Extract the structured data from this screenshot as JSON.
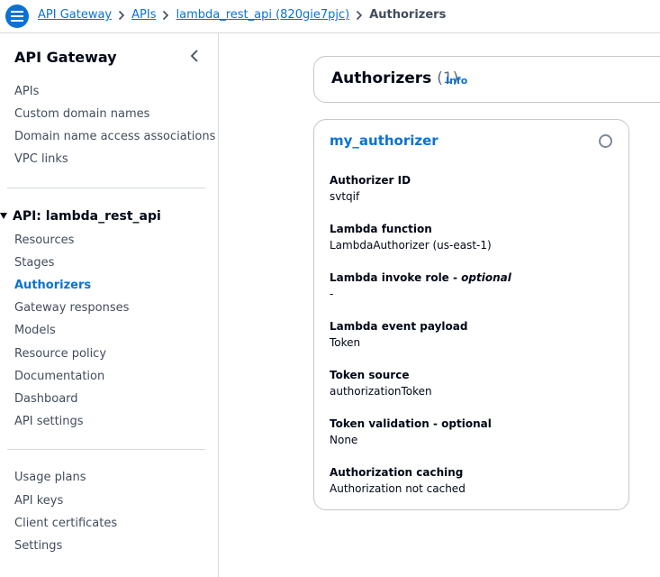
{
  "breadcrumb": {
    "items": [
      "API Gateway",
      "APIs",
      "lambda_rest_api (820gie7pjc)"
    ],
    "current": "Authorizers"
  },
  "sidebar": {
    "title": "API Gateway",
    "group1": [
      "APIs",
      "Custom domain names",
      "Domain name access associations",
      "VPC links"
    ],
    "section_title": "API: lambda_rest_api",
    "group2": [
      "Resources",
      "Stages",
      "Authorizers",
      "Gateway responses",
      "Models",
      "Resource policy",
      "Documentation",
      "Dashboard",
      "API settings"
    ],
    "group2_active": "Authorizers",
    "group3": [
      "Usage plans",
      "API keys",
      "Client certificates",
      "Settings"
    ]
  },
  "header": {
    "title": "Authorizers",
    "count": "(1)",
    "info_label": "Info"
  },
  "authorizer": {
    "name": "my_authorizer",
    "fields": [
      {
        "label": "Authorizer ID",
        "value": "svtqif"
      },
      {
        "label": "Lambda function",
        "value": "LambdaAuthorizer (us-east-1)"
      },
      {
        "label": "Lambda invoke role - ",
        "label_suffix": "optional",
        "value": "-"
      },
      {
        "label": "Lambda event payload",
        "value": "Token"
      },
      {
        "label": "Token source",
        "value": "authorizationToken"
      },
      {
        "label": "Token validation - optional",
        "value": "None"
      },
      {
        "label": "Authorization caching",
        "value": "Authorization not cached"
      }
    ]
  },
  "colors": {
    "accent": "#0972d3",
    "text": "#000716",
    "border": "#c6c6cd"
  }
}
